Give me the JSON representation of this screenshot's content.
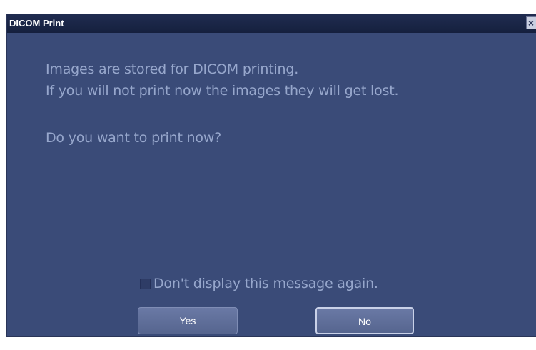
{
  "dialog": {
    "title": "DICOM Print",
    "close_glyph": "×",
    "message_line1": "Images are stored for DICOM printing.",
    "message_line2": "If you will not print now the images they will get lost.",
    "question": "Do you want to print now?",
    "checkbox": {
      "label_before": "Don't display this ",
      "label_mnemonic": "m",
      "label_after": "essage again.",
      "checked": false
    },
    "yes_label": "Yes",
    "no_label": "No"
  },
  "colors": {
    "dialog_background": "#3a4b78",
    "titlebar_background": "#15203e",
    "text": "#97a7cc",
    "button": "#5f6e99"
  }
}
